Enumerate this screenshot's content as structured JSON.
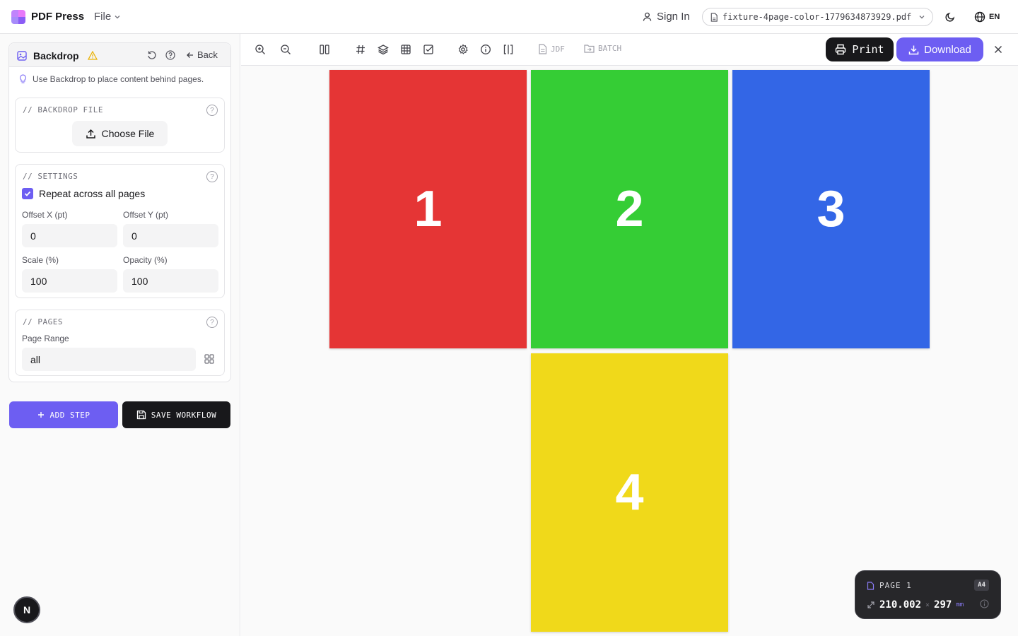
{
  "app": {
    "name": "PDF Press",
    "file_menu": "File"
  },
  "header": {
    "sign_in": "Sign In",
    "file_name": "fixture-4page-color-1779634873929.pdf",
    "language": "EN"
  },
  "sidebar": {
    "panel_title": "Backdrop",
    "back_label": "Back",
    "hint": "Use Backdrop to place content behind pages.",
    "backdrop_file": {
      "title": "// BACKDROP FILE",
      "choose_label": "Choose File"
    },
    "settings": {
      "title": "// SETTINGS",
      "repeat_label": "Repeat across all pages",
      "offset_x_label": "Offset X (pt)",
      "offset_x_value": "0",
      "offset_y_label": "Offset Y (pt)",
      "offset_y_value": "0",
      "scale_label": "Scale (%)",
      "scale_value": "100",
      "opacity_label": "Opacity (%)",
      "opacity_value": "100"
    },
    "pages": {
      "title": "// PAGES",
      "range_label": "Page Range",
      "range_value": "all"
    },
    "add_step": "ADD STEP",
    "save_workflow": "SAVE WORKFLOW",
    "badge": "N"
  },
  "toolbar": {
    "jdf_label": "JDF",
    "batch_label": "BATCH",
    "print_label": "Print",
    "download_label": "Download"
  },
  "pages": [
    {
      "label": "1",
      "color": "#e53535"
    },
    {
      "label": "2",
      "color": "#35cd35"
    },
    {
      "label": "3",
      "color": "#3366e6"
    },
    {
      "label": "4",
      "color": "#f0d91a"
    }
  ],
  "page_info": {
    "page_label": "PAGE 1",
    "size": "A4",
    "width": "210.002",
    "times": "×",
    "height": "297",
    "unit": "mm"
  },
  "colors": {
    "accent": "#6d5ef2",
    "dark": "#18181b"
  }
}
